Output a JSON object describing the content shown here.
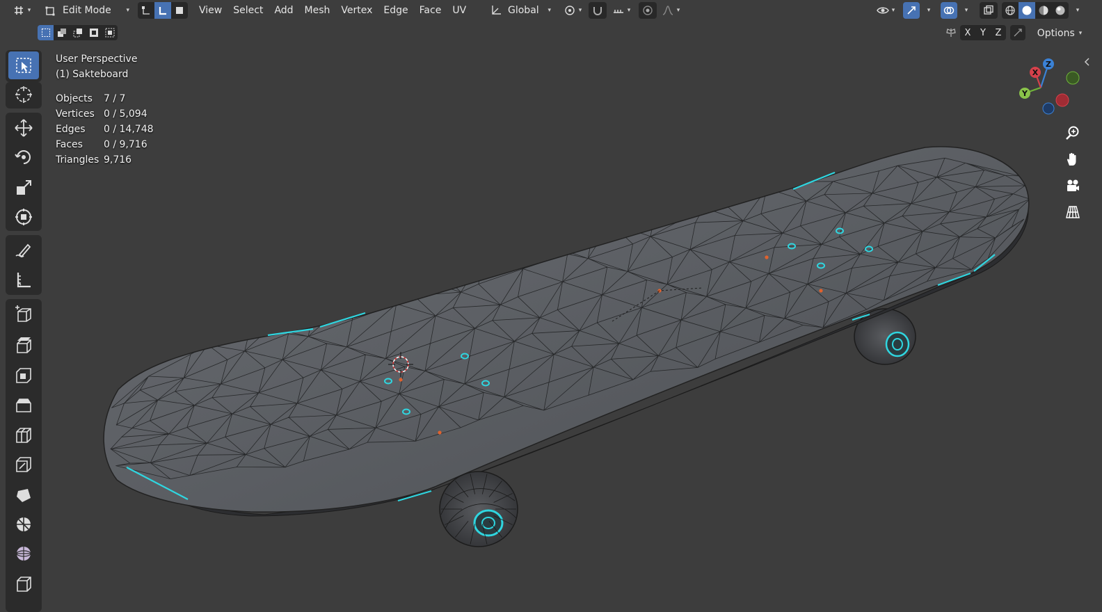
{
  "header": {
    "mode_label": "Edit Mode",
    "menus": [
      "View",
      "Select",
      "Add",
      "Mesh",
      "Vertex",
      "Edge",
      "Face",
      "UV"
    ],
    "orientation_label": "Global",
    "options_label": "Options",
    "axes": [
      "X",
      "Y",
      "Z"
    ]
  },
  "viewport": {
    "perspective": "User Perspective",
    "object_name": "(1) Sakteboard"
  },
  "stats": [
    {
      "label": "Objects",
      "value": "7 / 7"
    },
    {
      "label": "Vertices",
      "value": "0 / 5,094"
    },
    {
      "label": "Edges",
      "value": "0 / 14,748"
    },
    {
      "label": "Faces",
      "value": "0 / 9,716"
    },
    {
      "label": "Triangles",
      "value": "9,716"
    }
  ],
  "gizmo": {
    "x": "X",
    "y": "Y",
    "z": "Z"
  },
  "tools": [
    "select-box",
    "cursor",
    "move",
    "rotate",
    "scale",
    "transform",
    "annotate",
    "measure",
    "add-cube",
    "extrude",
    "inset",
    "bevel",
    "loop-cut",
    "knife",
    "poly-build",
    "spin",
    "smooth",
    "shear"
  ],
  "colors": {
    "accent": "#4772b3",
    "edge_highlight": "#2fd6e0",
    "vertex_orange": "#e0622e",
    "background": "#3d3d3d"
  }
}
